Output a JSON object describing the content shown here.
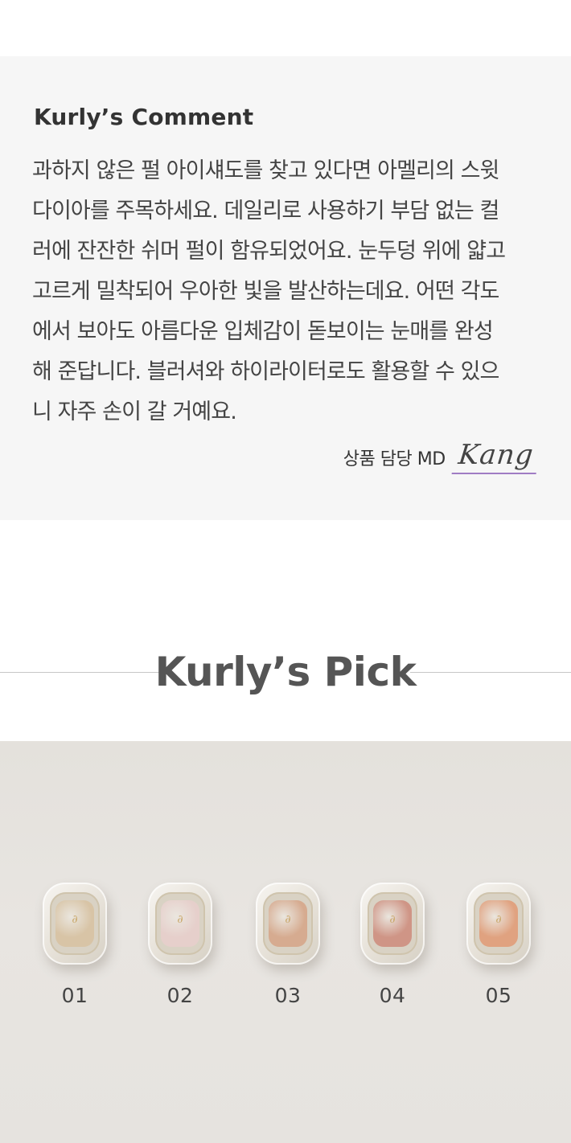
{
  "comment": {
    "title": "Kurly’s Comment",
    "lines": [
      "과하지 않은 펄 아이섀도를 찾고 있다면 아멜리의 스윗",
      "다이아를 주목하세요. 데일리로 사용하기 부담 없는 컬",
      "러에 잔잔한 쉬머 펄이 함유되었어요. 눈두덩 위에 얇고",
      "고르게 밀착되어 우아한 빛을 발산하는데요. 어떤 각도",
      "에서 보아도 아름다운 입체감이 돋보이는 눈매를 완성",
      "해 준답니다. 블러셔와 하이라이터로도 활용할 수 있으",
      "니 자주 손이 갈 거예요."
    ],
    "signature_label": "상품 담당 MD",
    "signature_name": "Kang",
    "signature_underline_color": "#a07cc4"
  },
  "pick": {
    "title": "Kurly’s Pick"
  },
  "products": [
    {
      "label": "01",
      "color": "#d8c4a6"
    },
    {
      "label": "02",
      "color": "#e6cfcb"
    },
    {
      "label": "03",
      "color": "#d6ab90"
    },
    {
      "label": "04",
      "color": "#cf9586"
    },
    {
      "label": "05",
      "color": "#e0a280"
    }
  ],
  "colors": {
    "comment_background": "#f6f6f6",
    "photo_background": "#e6e3df"
  }
}
